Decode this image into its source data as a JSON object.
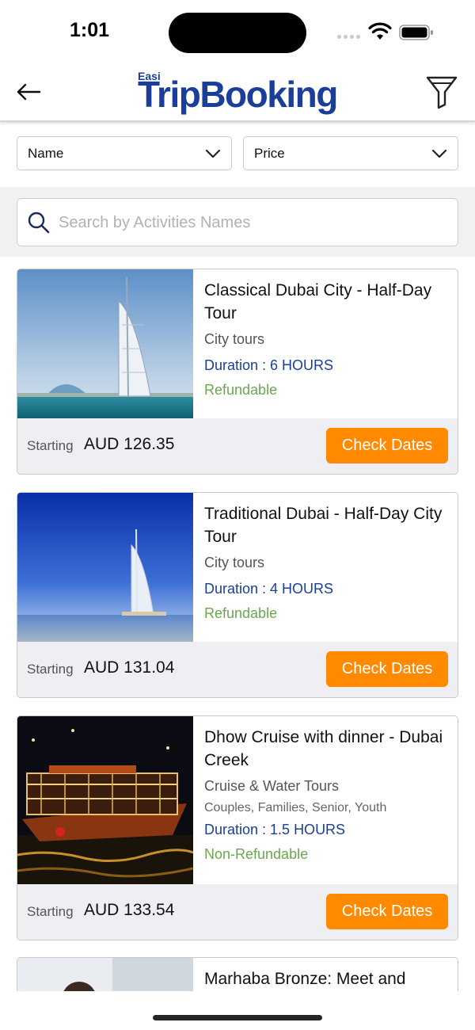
{
  "status_bar": {
    "time": "1:01"
  },
  "header": {
    "logo_small": "Easi",
    "logo_main": "TripBooking",
    "back_icon": "arrow-left-icon",
    "filter_icon": "funnel-icon"
  },
  "sort": {
    "name_label": "Name",
    "price_label": "Price"
  },
  "search": {
    "placeholder": "Search by Activities Names",
    "value": ""
  },
  "colors": {
    "brand_blue": "#1b3e9b",
    "accent_orange": "#ff8a00",
    "refund_green": "#6aa84f"
  },
  "activities": [
    {
      "title": "Classical Dubai City - Half-Day Tour",
      "category": "City tours",
      "duration": "Duration : 6 HOURS",
      "refund": "Refundable",
      "starting_label": "Starting",
      "price": "AUD 126.35",
      "button": "Check Dates"
    },
    {
      "title": "Traditional Dubai - Half-Day City Tour",
      "category": "City tours",
      "duration": "Duration : 4 HOURS",
      "refund": "Refundable",
      "starting_label": "Starting",
      "price": "AUD 131.04",
      "button": "Check Dates"
    },
    {
      "title": "Dhow Cruise with dinner - Dubai Creek",
      "category": "Cruise & Water Tours",
      "tags": "Couples, Families, Senior, Youth",
      "duration": "Duration : 1.5 HOURS",
      "refund": "Non-Refundable",
      "starting_label": "Starting",
      "price": "AUD 133.54",
      "button": "Check Dates"
    },
    {
      "title": "Marhaba Bronze: Meet and"
    }
  ]
}
